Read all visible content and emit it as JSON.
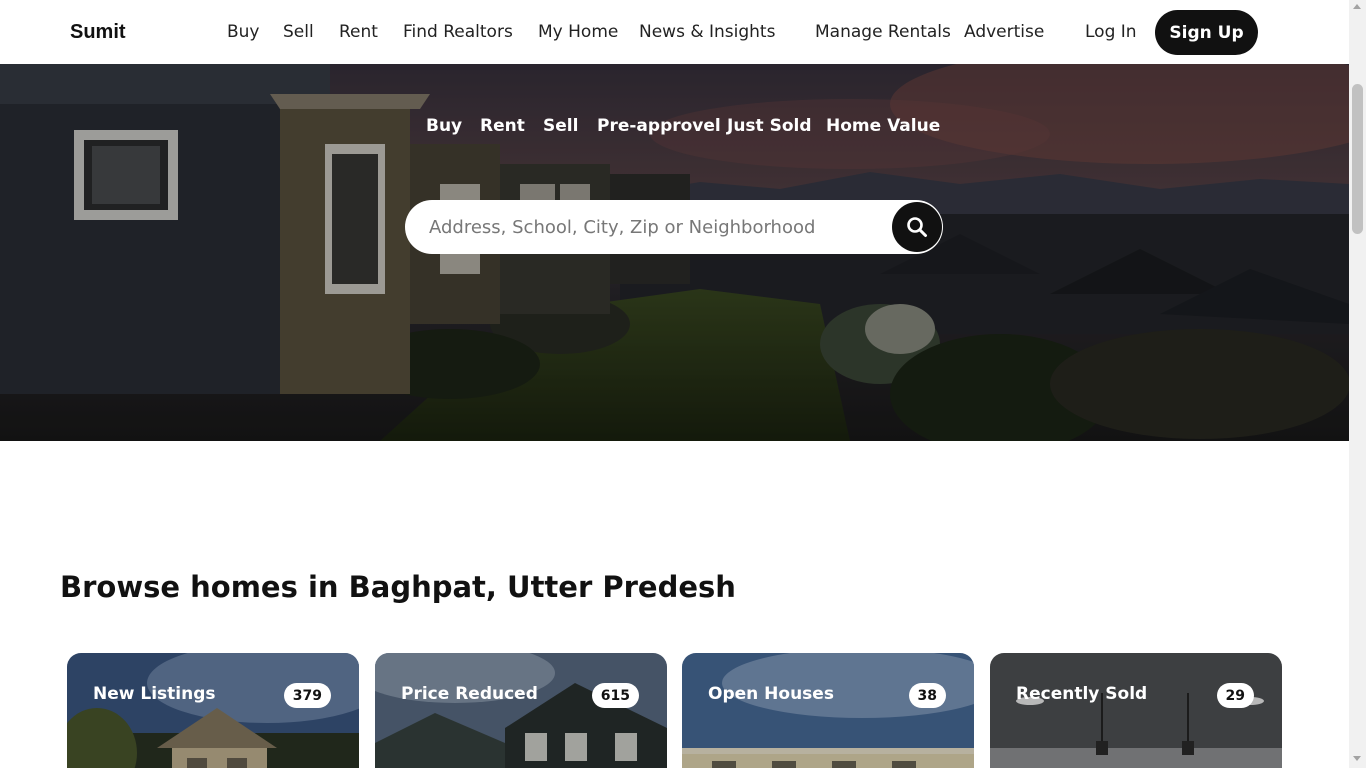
{
  "header": {
    "logo": "Sumit",
    "nav": [
      "Buy",
      "Sell",
      "Rent",
      "Find Realtors",
      "My Home",
      "News & Insights"
    ],
    "right_nav": [
      "Manage Rentals",
      "Advertise"
    ],
    "login": "Log In",
    "signup": "Sign Up"
  },
  "hero": {
    "tabs": [
      "Buy",
      "Rent",
      "Sell",
      "Pre-approvel",
      "Just Sold",
      "Home Value"
    ],
    "search_placeholder": "Address, School, City, Zip or Neighborhood",
    "search_icon": "search-icon"
  },
  "browse": {
    "title": "Browse homes in Baghpat, Utter Predesh",
    "cards": [
      {
        "label": "New Listings",
        "count": "379"
      },
      {
        "label": "Price Reduced",
        "count": "615"
      },
      {
        "label": "Open Houses",
        "count": "38"
      },
      {
        "label": "Recently Sold",
        "count": "29"
      }
    ]
  },
  "colors": {
    "primary_dark": "#111111",
    "background": "#ffffff",
    "hero_overlay": "#000000"
  }
}
